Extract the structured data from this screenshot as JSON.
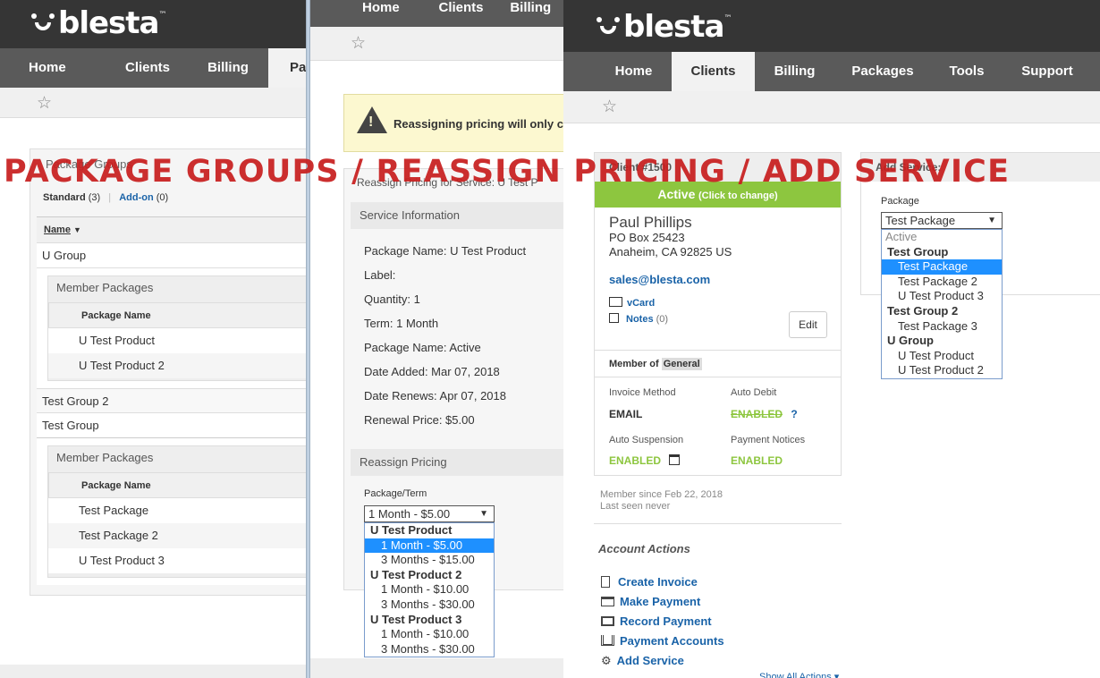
{
  "brand": {
    "name": "blesta",
    "tm": "™"
  },
  "overlay_title": "PACKAGE GROUPS / REASSIGN PRICING / ADD SERVICE",
  "left": {
    "nav": [
      "Home",
      "Clients",
      "Billing",
      "Pa"
    ],
    "section_title": "Package Groups",
    "tabs": {
      "standard": "Standard",
      "standard_count": "(3)",
      "sep": "|",
      "addon": "Add-on",
      "addon_count": "(0)"
    },
    "col_name": "Name",
    "groups": [
      {
        "name": "U Group",
        "members_title": "Member Packages",
        "col": "Package Name",
        "packages": [
          "U Test Product",
          "U Test Product 2"
        ]
      },
      {
        "name": "Test Group 2"
      },
      {
        "name": "Test Group",
        "members_title": "Member Packages",
        "col": "Package Name",
        "packages": [
          "Test Package",
          "Test Package 2",
          "U Test Product 3"
        ]
      }
    ]
  },
  "middle": {
    "nav": [
      "Home",
      "Clients",
      "Billing"
    ],
    "alert": "Reassigning pricing will only cl",
    "box_title": "Reassign Pricing for Service: U Test P",
    "service_info_title": "Service Information",
    "info": [
      "Package Name: U Test Product",
      "Label:",
      "Quantity: 1",
      "Term: 1 Month",
      "Package Name: Active",
      "Date Added: Mar 07, 2018",
      "Date Renews: Apr 07, 2018",
      "Renewal Price: $5.00"
    ],
    "reassign_title": "Reassign Pricing",
    "field_label": "Package/Term",
    "select_value": "1 Month - $5.00",
    "options": [
      {
        "g": "U Test Product",
        "items": [
          "1 Month - $5.00",
          "3 Months - $15.00"
        ]
      },
      {
        "g": "U Test Product 2",
        "items": [
          "1 Month - $10.00",
          "3 Months - $30.00"
        ]
      },
      {
        "g": "U Test Product 3",
        "items": [
          "1 Month - $10.00",
          "3 Months - $30.00"
        ]
      }
    ]
  },
  "right": {
    "nav": [
      "Home",
      "Clients",
      "Billing",
      "Packages",
      "Tools",
      "Support"
    ],
    "client_box_title": "Client #1500",
    "status": "Active",
    "status_hint": "(Click to change)",
    "client_name": "Paul Phillips",
    "address1": "PO Box 25423",
    "address2": "Anaheim, CA 92825 US",
    "email": "sales@blesta.com",
    "vcard": "vCard",
    "notes": "Notes",
    "notes_count": "(0)",
    "edit": "Edit",
    "member_of": "Member of",
    "group": "General",
    "invoice_method_label": "Invoice Method",
    "invoice_method": "EMAIL",
    "auto_debit_label": "Auto Debit",
    "auto_debit": "ENABLED",
    "help": "?",
    "auto_susp_label": "Auto Suspension",
    "auto_susp": "ENABLED",
    "pay_notices_label": "Payment Notices",
    "pay_notices": "ENABLED",
    "member_since": "Member since Feb 22, 2018",
    "last_seen": "Last seen never",
    "actions_title": "Account Actions",
    "actions": [
      "Create Invoice",
      "Make Payment",
      "Record Payment",
      "Payment Accounts",
      "Add Service"
    ],
    "show_all": "Show All Actions ▾",
    "add_service_title": "Add Service:",
    "package_label": "Package",
    "package_value": "Test Package",
    "package_options": {
      "disabled": "Active",
      "groups": [
        {
          "g": "Test Group",
          "items": [
            "Test Package",
            "Test Package 2",
            "U Test Product 3"
          ]
        },
        {
          "g": "Test Group 2",
          "items": [
            "Test Package 3"
          ]
        },
        {
          "g": "U Group",
          "items": [
            "U Test Product",
            "U Test Product 2"
          ]
        }
      ]
    }
  },
  "colors": {
    "accent": "#1a63a8",
    "active_green": "#8dc63f",
    "overlay_red": "#c81f1f",
    "nav_dark": "#353535"
  }
}
